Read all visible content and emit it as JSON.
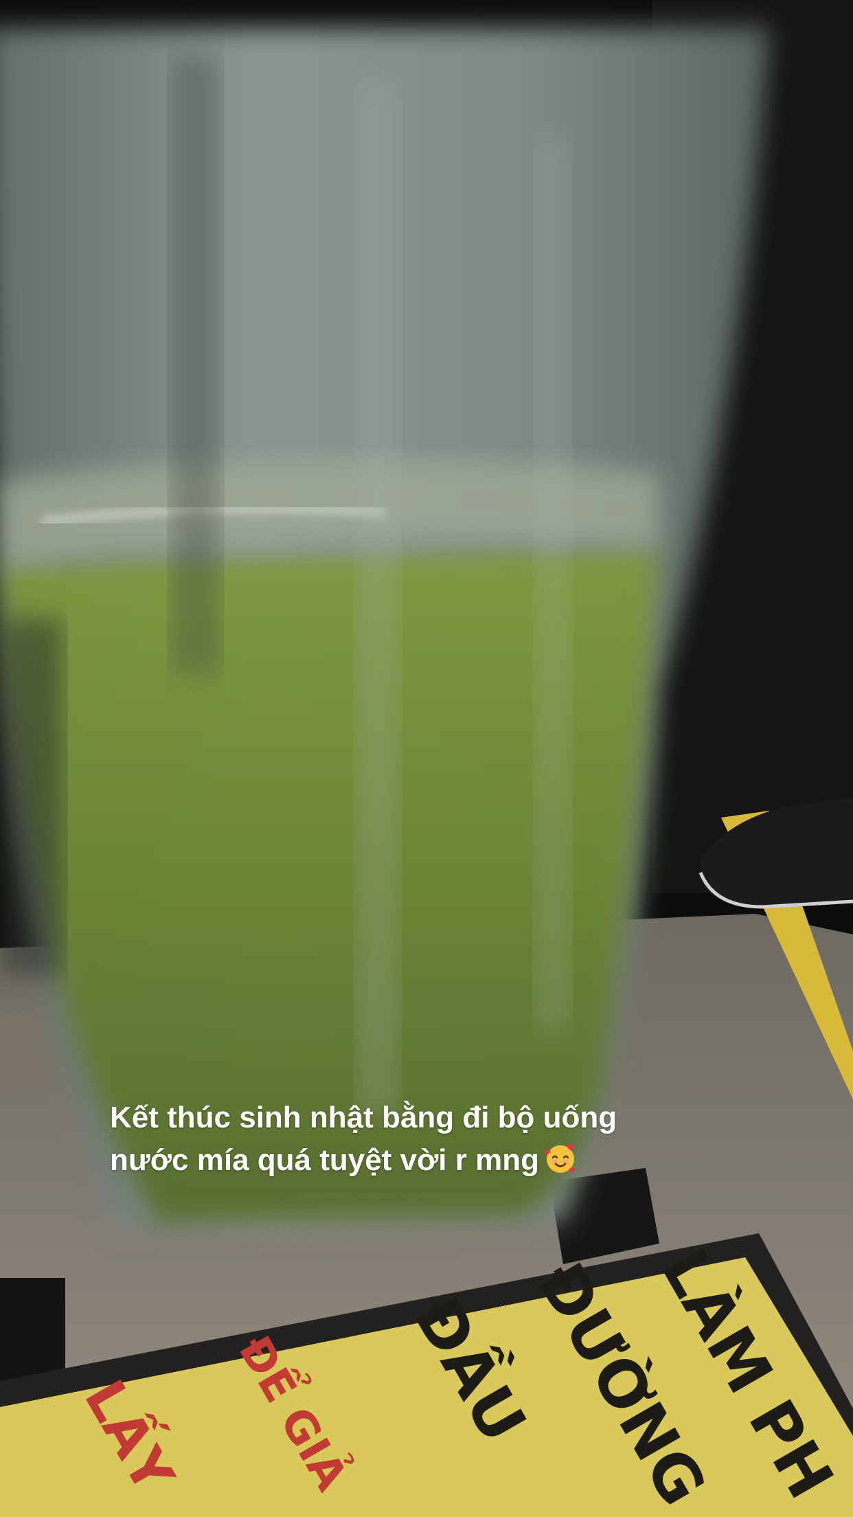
{
  "caption": {
    "text": "Kết thúc sinh nhật bằng đi bộ uống\nnước mía quá tuyệt vời r mng",
    "emoji_icon": "smiling-face-with-hearts-icon"
  },
  "sign": {
    "dark_lines": [
      "LÀM PH",
      "ĐƯỜNG",
      "ĐẦU"
    ],
    "red_lines": [
      "ĐỂ GIẢ",
      "LẤY"
    ],
    "bg_color": "#d8c95a",
    "ink_color": "#1d1b16",
    "red_color": "#c23a34"
  },
  "colors": {
    "juice": "#6f8a3a",
    "cup": "#7f8a86",
    "floor": "#8b8478",
    "curb_line": "#d8b93a",
    "background": "#0b0c0b"
  }
}
